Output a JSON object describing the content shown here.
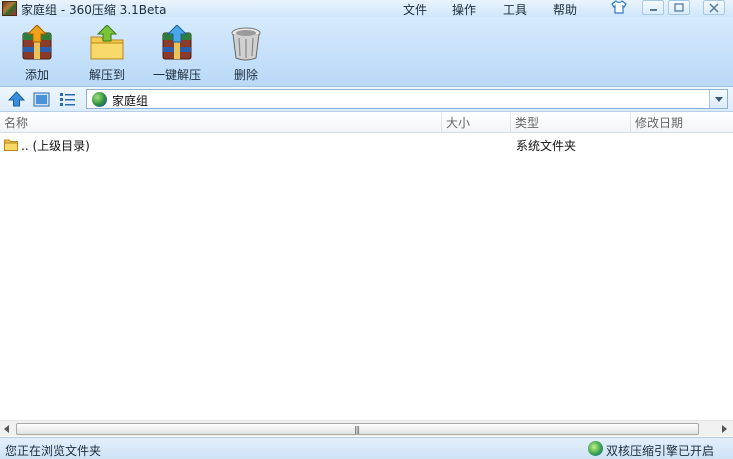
{
  "window": {
    "title": "家庭组 - 360压缩 3.1Beta"
  },
  "menu": {
    "file": "文件",
    "operate": "操作",
    "tools": "工具",
    "help": "帮助"
  },
  "toolbar": {
    "add_label": "添加",
    "extract_to_label": "解压到",
    "one_click_extract_label": "一键解压",
    "delete_label": "删除"
  },
  "address": {
    "value": "家庭组"
  },
  "columns": {
    "name": "名称",
    "size": "大小",
    "type": "类型",
    "modified": "修改日期"
  },
  "rows": [
    {
      "name": ".. (上级目录)",
      "size": "",
      "type": "系统文件夹",
      "modified": "",
      "icon": "folder-icon"
    }
  ],
  "status": {
    "left": "您正在浏览文件夹",
    "right": "双核压缩引擎已开启"
  },
  "colors": {
    "toolbar_bg": "#c4e0fa",
    "titlebar_bg": "#dcedfb",
    "accent": "#2a78c8"
  }
}
